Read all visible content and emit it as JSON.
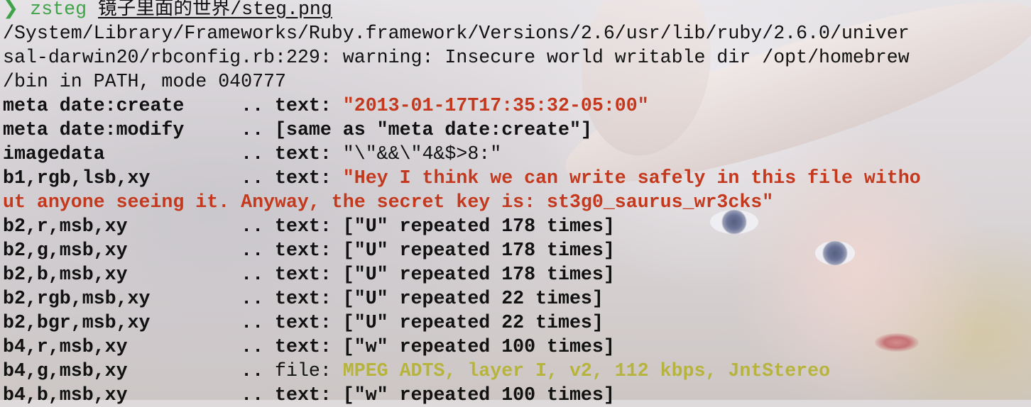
{
  "colors": {
    "prompt": "#3fa348",
    "text_default": "#111111",
    "string_value": "#c4391e",
    "file_value": "#b7b43d"
  },
  "prompt": {
    "symbol": "❯",
    "command": "zsteg",
    "path": "镜子里面的世界/steg.png"
  },
  "warning_lines": [
    "/System/Library/Frameworks/Ruby.framework/Versions/2.6/usr/lib/ruby/2.6.0/univer",
    "sal-darwin20/rbconfig.rb:229: warning: Insecure world writable dir /opt/homebrew",
    "/bin in PATH, mode 040777"
  ],
  "results": [
    {
      "key": "meta date:create    ",
      "sep": " .. ",
      "kind": "text: ",
      "value": "\"2013-01-17T17:35:32-05:00\""
    },
    {
      "key": "meta date:modify    ",
      "sep": " .. ",
      "kind": "",
      "value": "[same as \"meta date:create\"]"
    },
    {
      "key": "imagedata           ",
      "sep": " .. ",
      "kind": "text: ",
      "value": "\"\\\"&&\\\"4&$>8:\""
    },
    {
      "key": "b1,rgb,lsb,xy       ",
      "sep": " .. ",
      "kind": "text: ",
      "value": "\"Hey I think we can write safely in this file witho"
    },
    {
      "key": "",
      "sep": "",
      "kind": "",
      "value": "ut anyone seeing it. Anyway, the secret key is: st3g0_saurus_wr3cks\""
    },
    {
      "key": "b2,r,msb,xy         ",
      "sep": " .. ",
      "kind": "text: ",
      "value": "[\"U\" repeated 178 times]"
    },
    {
      "key": "b2,g,msb,xy         ",
      "sep": " .. ",
      "kind": "text: ",
      "value": "[\"U\" repeated 178 times]"
    },
    {
      "key": "b2,b,msb,xy         ",
      "sep": " .. ",
      "kind": "text: ",
      "value": "[\"U\" repeated 178 times]"
    },
    {
      "key": "b2,rgb,msb,xy       ",
      "sep": " .. ",
      "kind": "text: ",
      "value": "[\"U\" repeated 22 times]"
    },
    {
      "key": "b2,bgr,msb,xy       ",
      "sep": " .. ",
      "kind": "text: ",
      "value": "[\"U\" repeated 22 times]"
    },
    {
      "key": "b4,r,msb,xy         ",
      "sep": " .. ",
      "kind": "text: ",
      "value": "[\"w\" repeated 100 times]"
    },
    {
      "key": "b4,g,msb,xy         ",
      "sep": " .. ",
      "kind": "file: ",
      "value": "MPEG ADTS, layer I, v2, 112 kbps, JntStereo"
    },
    {
      "key": "b4,b,msb,xy         ",
      "sep": " .. ",
      "kind": "text: ",
      "value": "[\"w\" repeated 100 times]"
    }
  ]
}
